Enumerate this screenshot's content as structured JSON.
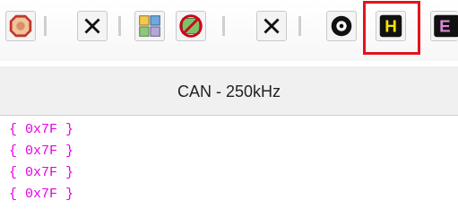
{
  "toolbar": {
    "buttons": [
      {
        "icon": "stop-hand-icon"
      },
      {
        "icon": "close-icon"
      },
      {
        "icon": "network-icon"
      },
      {
        "icon": "no-connect-icon"
      },
      {
        "icon": "close-icon"
      },
      {
        "icon": "record-icon"
      },
      {
        "icon": "hex-h-icon",
        "label": "H",
        "highlighted": true
      },
      {
        "icon": "mode-e-icon",
        "label": "E"
      }
    ],
    "highlight_color": "#e1141d"
  },
  "header": {
    "title": "CAN - 250kHz"
  },
  "log": {
    "lines": [
      "{ 0x7F }",
      "{ 0x7F }",
      "{ 0x7F }",
      "{ 0x7F }"
    ],
    "color": "#e600e6"
  }
}
